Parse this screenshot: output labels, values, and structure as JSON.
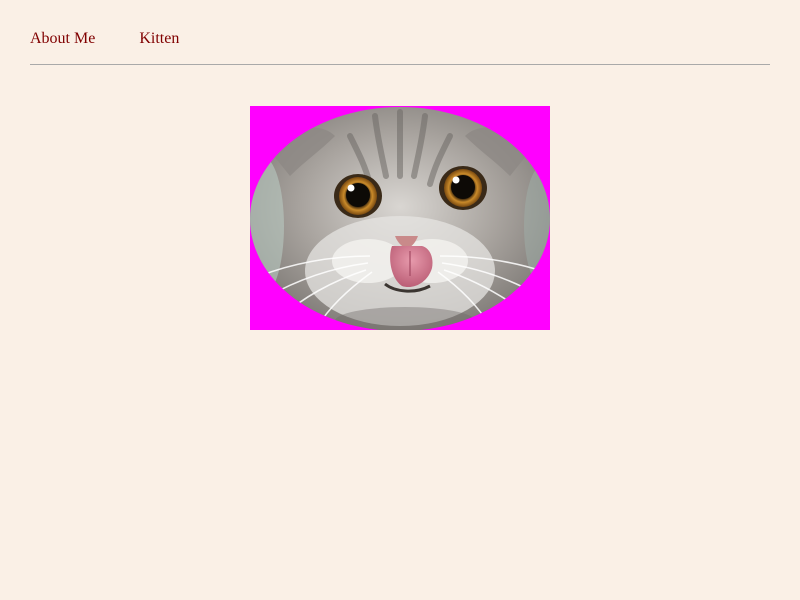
{
  "nav": {
    "items": [
      {
        "label": "About Me"
      },
      {
        "label": "Kitten"
      }
    ]
  },
  "photo": {
    "subject": "kitten-photo",
    "matte_color": "#ff00ff"
  }
}
